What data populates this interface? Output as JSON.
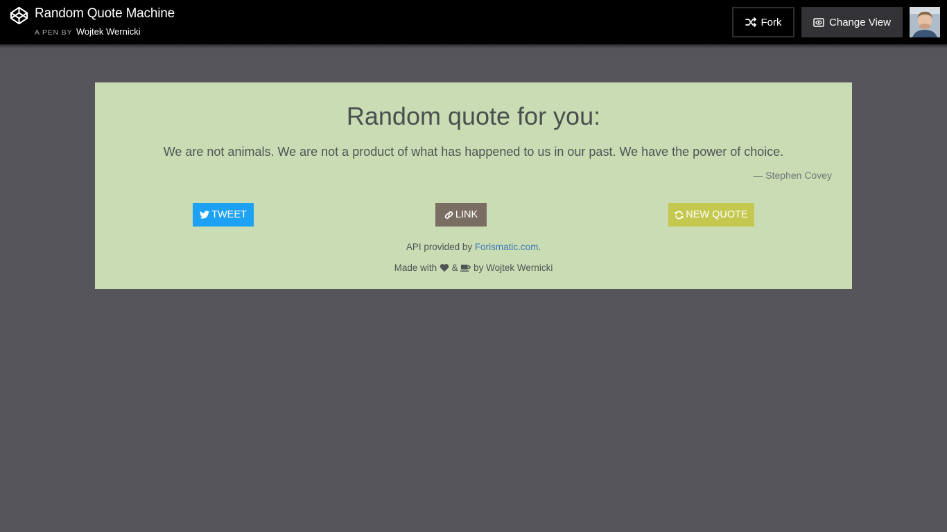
{
  "header": {
    "title": "Random Quote Machine",
    "pen_by": "A PEN BY",
    "author": "Wojtek Wernicki",
    "fork_label": "Fork",
    "change_view_label": "Change View"
  },
  "card": {
    "title": "Random quote for you:",
    "quote": "We are not animals. We are not a product of what has happened to us in our past. We have the power of choice.",
    "author": "— Stephen Covey",
    "buttons": {
      "tweet": "TWEET",
      "link": "LINK",
      "new_quote": "NEW QUOTE"
    },
    "api_prefix": "API provided by ",
    "api_link": "Forismatic.com",
    "api_suffix": ".",
    "made_prefix": "Made with ",
    "made_and": " & ",
    "made_suffix": " by Wojtek Wernicki"
  },
  "colors": {
    "page_bg": "#56555b",
    "card_bg": "#c9dcb3",
    "tweet": "#1da1f2",
    "link": "#7a6e63",
    "new_quote": "#c5c84f"
  },
  "icons": [
    "codepen-logo-icon",
    "fork-icon",
    "eye-icon",
    "twitter-icon",
    "link-icon",
    "refresh-icon",
    "heart-icon",
    "coffee-icon"
  ]
}
